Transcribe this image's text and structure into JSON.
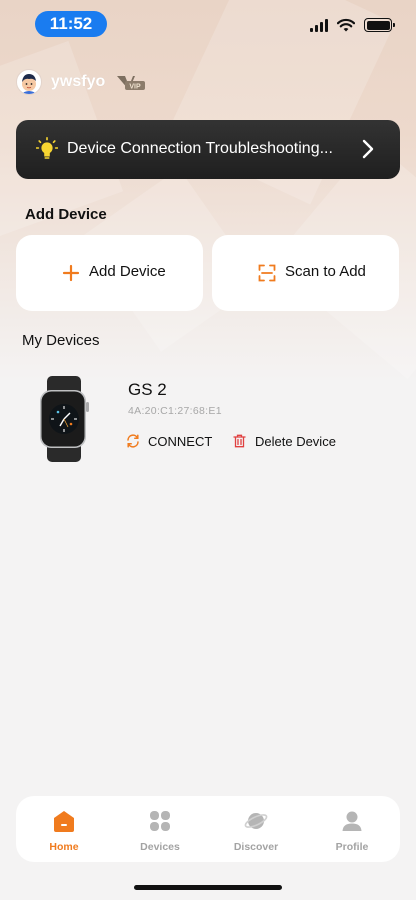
{
  "status_bar": {
    "time": "11:52"
  },
  "user": {
    "username": "ywsfyo",
    "badge": "VIP"
  },
  "banner": {
    "text": "Device Connection Troubleshooting..."
  },
  "add_device_section": {
    "title": "Add Device",
    "add_label": "Add Device",
    "scan_label": "Scan to Add"
  },
  "my_devices": {
    "title": "My Devices",
    "devices": [
      {
        "name": "GS 2",
        "mac": "4A:20:C1:27:68:E1",
        "connect_label": "CONNECT",
        "delete_label": "Delete Device"
      }
    ]
  },
  "tab_bar": {
    "tabs": [
      {
        "label": "Home",
        "icon": "home-icon",
        "active": true
      },
      {
        "label": "Devices",
        "icon": "devices-icon",
        "active": false
      },
      {
        "label": "Discover",
        "icon": "planet-icon",
        "active": false
      },
      {
        "label": "Profile",
        "icon": "profile-icon",
        "active": false
      }
    ]
  },
  "colors": {
    "accent": "#f07b1e",
    "status_time_pill": "#1a7cf0",
    "banner_bg": "#262626",
    "delete_red": "#e04040"
  }
}
